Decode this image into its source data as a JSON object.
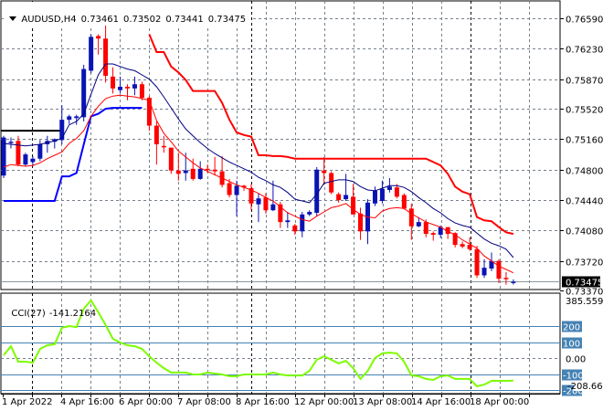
{
  "header": {
    "menu_icon": "triangle-down-icon",
    "symbol": "AUDUSD,H4",
    "open": "0.73461",
    "high": "0.73502",
    "low": "0.73441",
    "close": "0.73475"
  },
  "colors": {
    "bull": "#0a14b4",
    "bear": "#ff0000",
    "ma_slow": "#000080",
    "ma_fast": "#ff0000",
    "upper_band": "#ff0000",
    "lower_band": "#0000ff",
    "level_line": "#000000",
    "cci": "#7cfc00",
    "cci_levels": "#4682b4",
    "grid": "#77808c"
  },
  "chart_data": {
    "type": "candlestick",
    "title": "AUDUSD,H4",
    "price_ticks": [
      "0.76590",
      "0.76230",
      "0.75870",
      "0.75520",
      "0.75160",
      "0.74800",
      "0.74440",
      "0.74080",
      "0.73720",
      "0.73370"
    ],
    "bid_label": "0.73475",
    "bid_value": 0.73475,
    "ylim": [
      0.7337,
      0.7662
    ],
    "time_labels": [
      "1 Apr 2022",
      "4 Apr 16:00",
      "6 Apr 00:00",
      "7 Apr 08:00",
      "8 Apr 16:00",
      "12 Apr 00:00",
      "13 Apr 08:00",
      "14 Apr 16:00",
      "18 Apr 00:00"
    ],
    "candles": [
      [
        0.7473,
        0.752,
        0.747,
        0.7518
      ],
      [
        0.7512,
        0.7518,
        0.7505,
        0.7513
      ],
      [
        0.7514,
        0.752,
        0.7484,
        0.7486
      ],
      [
        0.7486,
        0.75,
        0.7484,
        0.7498
      ],
      [
        0.7489,
        0.7496,
        0.7484,
        0.7493
      ],
      [
        0.7493,
        0.7515,
        0.749,
        0.751
      ],
      [
        0.751,
        0.752,
        0.75,
        0.7514
      ],
      [
        0.7513,
        0.7517,
        0.7505,
        0.7516
      ],
      [
        0.7515,
        0.7556,
        0.751,
        0.7539
      ],
      [
        0.7539,
        0.7545,
        0.7534,
        0.7543
      ],
      [
        0.7541,
        0.7545,
        0.7533,
        0.7543
      ],
      [
        0.7542,
        0.7604,
        0.7537,
        0.7599
      ],
      [
        0.7597,
        0.764,
        0.7594,
        0.7637
      ],
      [
        0.7638,
        0.764,
        0.7616,
        0.7635
      ],
      [
        0.7635,
        0.766,
        0.7583,
        0.7591
      ],
      [
        0.759,
        0.7601,
        0.757,
        0.7576
      ],
      [
        0.7574,
        0.759,
        0.757,
        0.7578
      ],
      [
        0.7578,
        0.7581,
        0.7562,
        0.7576
      ],
      [
        0.7576,
        0.759,
        0.7568,
        0.7581
      ],
      [
        0.7581,
        0.7584,
        0.7562,
        0.7565
      ],
      [
        0.7565,
        0.7567,
        0.7526,
        0.7532
      ],
      [
        0.7532,
        0.7537,
        0.7486,
        0.751
      ],
      [
        0.7508,
        0.752,
        0.75,
        0.7507
      ],
      [
        0.7506,
        0.7506,
        0.7475,
        0.7479
      ],
      [
        0.7479,
        0.75,
        0.7467,
        0.7475
      ],
      [
        0.7476,
        0.75,
        0.7467,
        0.7479
      ],
      [
        0.7481,
        0.7493,
        0.7467,
        0.7469
      ],
      [
        0.7469,
        0.749,
        0.7468,
        0.7481
      ],
      [
        0.7481,
        0.7486,
        0.7476,
        0.748
      ],
      [
        0.748,
        0.7495,
        0.7473,
        0.7478
      ],
      [
        0.7478,
        0.7496,
        0.7459,
        0.7462
      ],
      [
        0.7464,
        0.7469,
        0.7447,
        0.745
      ],
      [
        0.745,
        0.7467,
        0.7425,
        0.7461
      ],
      [
        0.7461,
        0.7462,
        0.7455,
        0.7459
      ],
      [
        0.7458,
        0.7463,
        0.7432,
        0.744
      ],
      [
        0.7439,
        0.7452,
        0.7418,
        0.7446
      ],
      [
        0.7447,
        0.7452,
        0.7428,
        0.7432
      ],
      [
        0.7432,
        0.7467,
        0.7431,
        0.7439
      ],
      [
        0.7439,
        0.7442,
        0.7411,
        0.7418
      ],
      [
        0.7418,
        0.743,
        0.7411,
        0.742
      ],
      [
        0.7414,
        0.7416,
        0.7403,
        0.7407
      ],
      [
        0.7407,
        0.743,
        0.74,
        0.7427
      ],
      [
        0.7427,
        0.7432,
        0.7425,
        0.743
      ],
      [
        0.7429,
        0.7483,
        0.7425,
        0.748
      ],
      [
        0.7479,
        0.7495,
        0.7462,
        0.7476
      ],
      [
        0.7476,
        0.7478,
        0.7451,
        0.7453
      ],
      [
        0.7451,
        0.7453,
        0.7441,
        0.7444
      ],
      [
        0.7445,
        0.7475,
        0.7443,
        0.745
      ],
      [
        0.7448,
        0.7463,
        0.7427,
        0.7427
      ],
      [
        0.7428,
        0.7435,
        0.7397,
        0.7407
      ],
      [
        0.7407,
        0.7445,
        0.7392,
        0.7441
      ],
      [
        0.744,
        0.746,
        0.7437,
        0.7455
      ],
      [
        0.7443,
        0.7467,
        0.744,
        0.7457
      ],
      [
        0.7456,
        0.747,
        0.7453,
        0.746
      ],
      [
        0.7459,
        0.7463,
        0.7446,
        0.7448
      ],
      [
        0.745,
        0.7452,
        0.7433,
        0.7434
      ],
      [
        0.7434,
        0.744,
        0.7397,
        0.7413
      ],
      [
        0.7413,
        0.7424,
        0.7412,
        0.7418
      ],
      [
        0.7418,
        0.7421,
        0.74,
        0.7404
      ],
      [
        0.7405,
        0.7407,
        0.7396,
        0.7403
      ],
      [
        0.7403,
        0.7414,
        0.7399,
        0.7412
      ],
      [
        0.7412,
        0.7412,
        0.7398,
        0.7404
      ],
      [
        0.7405,
        0.7406,
        0.7388,
        0.7391
      ],
      [
        0.7392,
        0.7395,
        0.7387,
        0.7389
      ],
      [
        0.7391,
        0.74,
        0.7384,
        0.7386
      ],
      [
        0.7386,
        0.739,
        0.7352,
        0.7355
      ],
      [
        0.7355,
        0.7374,
        0.7352,
        0.7364
      ],
      [
        0.7363,
        0.7382,
        0.736,
        0.7372
      ],
      [
        0.7372,
        0.7374,
        0.7346,
        0.7351
      ],
      [
        0.7352,
        0.7359,
        0.7344,
        0.7351
      ],
      [
        0.73461,
        0.73502,
        0.73441,
        0.73475
      ]
    ],
    "indicators": {
      "ma_slow": [
        0.7511,
        0.751,
        0.7509,
        0.7508,
        0.7509,
        0.751,
        0.7512,
        0.7514,
        0.7517,
        0.7533,
        0.7537,
        0.7546,
        0.7569,
        0.7592,
        0.7605,
        0.7605,
        0.7602,
        0.7599,
        0.7597,
        0.7592,
        0.7587,
        0.7578,
        0.7566,
        0.7553,
        0.754,
        0.7528,
        0.752,
        0.7512,
        0.7505,
        0.7499,
        0.7494,
        0.7489,
        0.7485,
        0.7481,
        0.7477,
        0.7471,
        0.7467,
        0.7462,
        0.7459,
        0.7453,
        0.7445,
        0.7443,
        0.7441,
        0.7451,
        0.7464,
        0.7466,
        0.7468,
        0.7468,
        0.7466,
        0.746,
        0.7456,
        0.7455,
        0.7458,
        0.7461,
        0.7461,
        0.7459,
        0.7454,
        0.7447,
        0.7441,
        0.7434,
        0.7429,
        0.7422,
        0.7417,
        0.7414,
        0.7412,
        0.7405,
        0.7398,
        0.7393,
        0.739,
        0.7386,
        0.7376
      ],
      "ma_fast": [
        0.7483,
        0.7486,
        0.7485,
        0.7484,
        0.7485,
        0.7488,
        0.7493,
        0.7497,
        0.7501,
        0.7511,
        0.7517,
        0.7526,
        0.7543,
        0.7555,
        0.7564,
        0.7567,
        0.7568,
        0.7567,
        0.7566,
        0.7564,
        0.7562,
        0.7538,
        0.7523,
        0.7513,
        0.7502,
        0.7495,
        0.7488,
        0.7482,
        0.7478,
        0.7474,
        0.747,
        0.7466,
        0.7462,
        0.7459,
        0.7456,
        0.7452,
        0.7447,
        0.7443,
        0.7436,
        0.7429,
        0.7425,
        0.7421,
        0.7419,
        0.7425,
        0.743,
        0.7435,
        0.7437,
        0.744,
        0.7433,
        0.7427,
        0.7424,
        0.7423,
        0.7431,
        0.7434,
        0.7435,
        0.7434,
        0.7428,
        0.7423,
        0.7418,
        0.7415,
        0.7412,
        0.7407,
        0.7403,
        0.7397,
        0.7392,
        0.7387,
        0.7378,
        0.7372,
        0.7366,
        0.7362,
        0.7358
      ],
      "upper_band": [
        null,
        null,
        null,
        null,
        null,
        null,
        null,
        null,
        null,
        null,
        null,
        null,
        null,
        null,
        null,
        null,
        null,
        null,
        null,
        null,
        0.764,
        0.7619,
        0.7619,
        0.7602,
        0.7595,
        0.7586,
        0.7573,
        0.7573,
        0.7573,
        0.7573,
        0.7559,
        0.7539,
        0.7524,
        0.7521,
        0.7519,
        0.7497,
        0.7497,
        0.7496,
        0.7496,
        0.7495,
        0.7493,
        0.7493,
        0.7493,
        0.7493,
        0.7493,
        0.7493,
        0.7493,
        0.7493,
        0.7493,
        0.7493,
        0.7493,
        0.7493,
        0.7493,
        0.7493,
        0.7493,
        0.7493,
        0.7493,
        0.7493,
        0.7493,
        0.7489,
        0.7485,
        0.7475,
        0.746,
        0.7454,
        0.7451,
        0.7424,
        0.742,
        0.7419,
        0.7412,
        0.7406,
        0.7404
      ],
      "lower_band": [
        0.7443,
        0.7443,
        0.7443,
        0.7443,
        0.7443,
        0.7443,
        0.7443,
        0.7443,
        0.7472,
        0.7472,
        0.7476,
        0.751,
        0.7543,
        0.7546,
        0.7552,
        0.7553,
        0.7553,
        0.7553,
        0.7553,
        0.7553
      ],
      "level_line": {
        "value": 0.7526,
        "from_index": 0,
        "to_index": 7
      }
    },
    "cci": {
      "label": "CCI(27)",
      "value": "-141.2164",
      "max_label": "385.5598",
      "min_label": "-208.6649",
      "ylim": [
        -208.6649,
        385.5598
      ],
      "levels": [
        200,
        100,
        -100,
        -200
      ],
      "level_labels": [
        "200",
        "100",
        "-100",
        "-200"
      ],
      "zero_label": "0.00",
      "values": [
        17,
        74,
        -23,
        -23,
        -29,
        57,
        80,
        86,
        189,
        200,
        194,
        309,
        360,
        286,
        206,
        120,
        97,
        80,
        74,
        57,
        11,
        -29,
        -63,
        -91,
        -91,
        -91,
        -103,
        -103,
        -91,
        -97,
        -103,
        -114,
        -114,
        -103,
        -103,
        -103,
        -103,
        -91,
        -103,
        -109,
        -109,
        -109,
        -80,
        -11,
        11,
        -11,
        -34,
        -17,
        -63,
        -131,
        -80,
        0,
        29,
        34,
        29,
        -23,
        -109,
        -114,
        -131,
        -137,
        -114,
        -109,
        -131,
        -131,
        -131,
        -177,
        -166,
        -143,
        -143,
        -143,
        -141.2
      ]
    }
  }
}
